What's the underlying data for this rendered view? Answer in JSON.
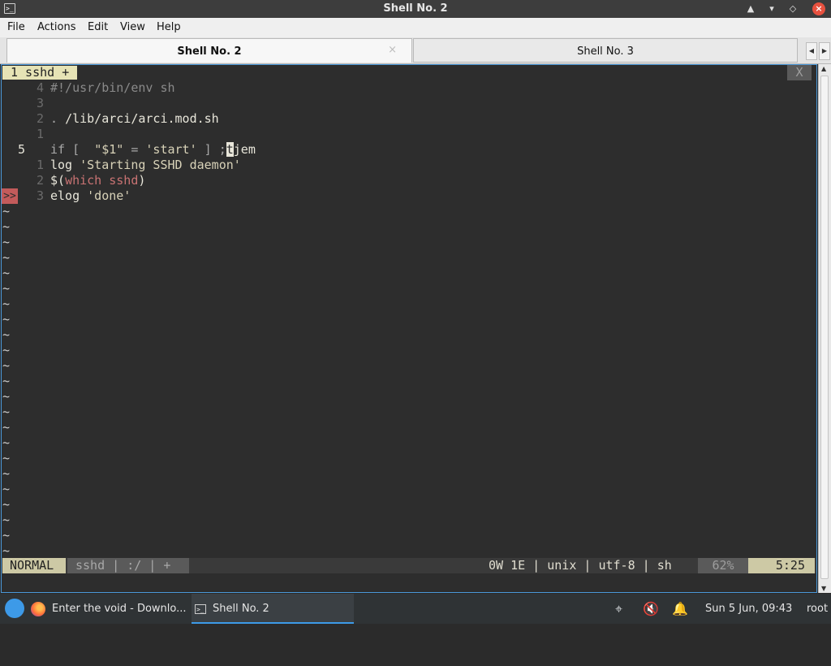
{
  "window": {
    "title": "Shell No. 2"
  },
  "menu": [
    "File",
    "Actions",
    "Edit",
    "View",
    "Help"
  ],
  "tabs": [
    {
      "label": "Shell No. 2",
      "active": true
    },
    {
      "label": "Shell No. 3",
      "active": false
    }
  ],
  "buffer_tab": {
    "label": "1 sshd +",
    "close_label": "X"
  },
  "editor_lines": [
    {
      "num": "4",
      "parts": [
        {
          "t": "#!/usr/bin/env sh",
          "c": "c-comment"
        }
      ]
    },
    {
      "num": "3",
      "parts": []
    },
    {
      "num": "2",
      "parts": [
        {
          "t": ". ",
          "c": "c-dim"
        },
        {
          "t": "/lib/arci/arci.mod.sh",
          "c": ""
        }
      ]
    },
    {
      "num": "1",
      "parts": []
    },
    {
      "num": "5",
      "current": true,
      "parts": [
        {
          "t": "if [  ",
          "c": "c-dim"
        },
        {
          "t": "\"$1\"",
          "c": "c-str"
        },
        {
          "t": " = ",
          "c": "c-dim"
        },
        {
          "t": "'start'",
          "c": "c-str"
        },
        {
          "t": " ] ;",
          "c": "c-dim"
        },
        {
          "t": "t",
          "c": "cursor"
        },
        {
          "t": "jem",
          "c": ""
        }
      ]
    },
    {
      "num": "1",
      "parts": [
        {
          "t": "log ",
          "c": ""
        },
        {
          "t": "'Starting SSHD daemon'",
          "c": "c-str"
        }
      ]
    },
    {
      "num": "2",
      "parts": [
        {
          "t": "$(",
          "c": ""
        },
        {
          "t": "which sshd",
          "c": "c-red"
        },
        {
          "t": ")",
          "c": ""
        }
      ]
    },
    {
      "num": "3",
      "sign": ">>",
      "parts": [
        {
          "t": "elog ",
          "c": ""
        },
        {
          "t": "'done'",
          "c": "c-str"
        }
      ]
    }
  ],
  "tilde": "~",
  "statusline": {
    "mode": "NORMAL",
    "file_section": "sshd | :/ | +",
    "info": "0W 1E | unix | utf-8 | sh",
    "percent": "62%",
    "position": "5:25"
  },
  "taskbar": {
    "tasks": [
      {
        "label": "Enter the void - Downlo...",
        "active": false
      },
      {
        "label": "Shell No. 2",
        "active": true
      }
    ],
    "clock": "Sun  5 Jun, 09:43",
    "user": "root"
  }
}
